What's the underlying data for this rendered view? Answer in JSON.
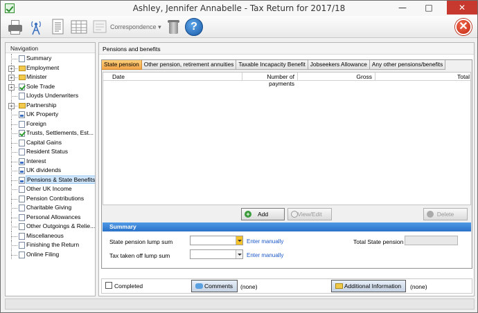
{
  "window": {
    "title": "Ashley, Jennifer Annabelle - Tax Return for 2017/18",
    "minimize_glyph": "—",
    "maximize_glyph": "□",
    "close_glyph": "✕"
  },
  "toolbar": {
    "correspondence_label": "Correspondence",
    "correspondence_arrow": "▾",
    "help_glyph": "?",
    "exit_glyph": "✕"
  },
  "navigation": {
    "heading": "Navigation",
    "items": [
      {
        "label": "Summary",
        "icon": "doc",
        "expandable": false
      },
      {
        "label": "Employment",
        "icon": "folder",
        "expandable": true
      },
      {
        "label": "Minister",
        "icon": "folder",
        "expandable": true
      },
      {
        "label": "Sole Trade",
        "icon": "check",
        "expandable": true
      },
      {
        "label": "Lloyds Underwriters",
        "icon": "doc",
        "expandable": false
      },
      {
        "label": "Partnership",
        "icon": "folder",
        "expandable": true
      },
      {
        "label": "UK Property",
        "icon": "blue",
        "expandable": false
      },
      {
        "label": "Foreign",
        "icon": "doc",
        "expandable": false
      },
      {
        "label": "Trusts, Settlements, Est...",
        "icon": "check",
        "expandable": false
      },
      {
        "label": "Capital Gains",
        "icon": "doc",
        "expandable": false
      },
      {
        "label": "Resident Status",
        "icon": "doc",
        "expandable": false
      },
      {
        "label": "Interest",
        "icon": "blue",
        "expandable": false
      },
      {
        "label": "UK dividends",
        "icon": "blue",
        "expandable": false
      },
      {
        "label": "Pensions & State Benefits",
        "icon": "blue",
        "expandable": false,
        "selected": true
      },
      {
        "label": "Other UK Income",
        "icon": "doc",
        "expandable": false
      },
      {
        "label": "Pension Contributions",
        "icon": "doc",
        "expandable": false
      },
      {
        "label": "Charitable Giving",
        "icon": "doc",
        "expandable": false
      },
      {
        "label": "Personal Allowances",
        "icon": "doc",
        "expandable": false
      },
      {
        "label": "Other Outgoings & Relie...",
        "icon": "doc",
        "expandable": false
      },
      {
        "label": "Miscellaneous",
        "icon": "doc",
        "expandable": false
      },
      {
        "label": "Finishing the Return",
        "icon": "doc",
        "expandable": false
      },
      {
        "label": "Online Filing",
        "icon": "doc",
        "expandable": false
      }
    ]
  },
  "main": {
    "heading": "Pensions and benefits",
    "tabs": [
      "State pension",
      "Other pension, retirement annuities",
      "Taxable Incapacity Benefit",
      "Jobseekers Allowance",
      "Any other pensions/benefits"
    ],
    "grid_columns": [
      "Date",
      "Number of payments",
      "Gross",
      "Total"
    ],
    "buttons": {
      "add": "Add",
      "view_edit": "View/Edit",
      "delete": "Delete"
    },
    "summary": {
      "heading": "Summary",
      "lump_sum_label": "State pension lump sum",
      "tax_taken_label": "Tax taken off lump sum",
      "enter_manually": "Enter manually",
      "total_label": "Total State pension"
    },
    "footer": {
      "completed_label": "Completed",
      "comments_label": "Comments",
      "comments_value": "(none)",
      "additional_label": "Additional Information",
      "additional_value": "(none)"
    }
  },
  "colors": {
    "active_tab": "#f3a64a",
    "summary_bar": "#2a72c8",
    "link": "#1a56c8",
    "selection": "#cfe6fb"
  }
}
